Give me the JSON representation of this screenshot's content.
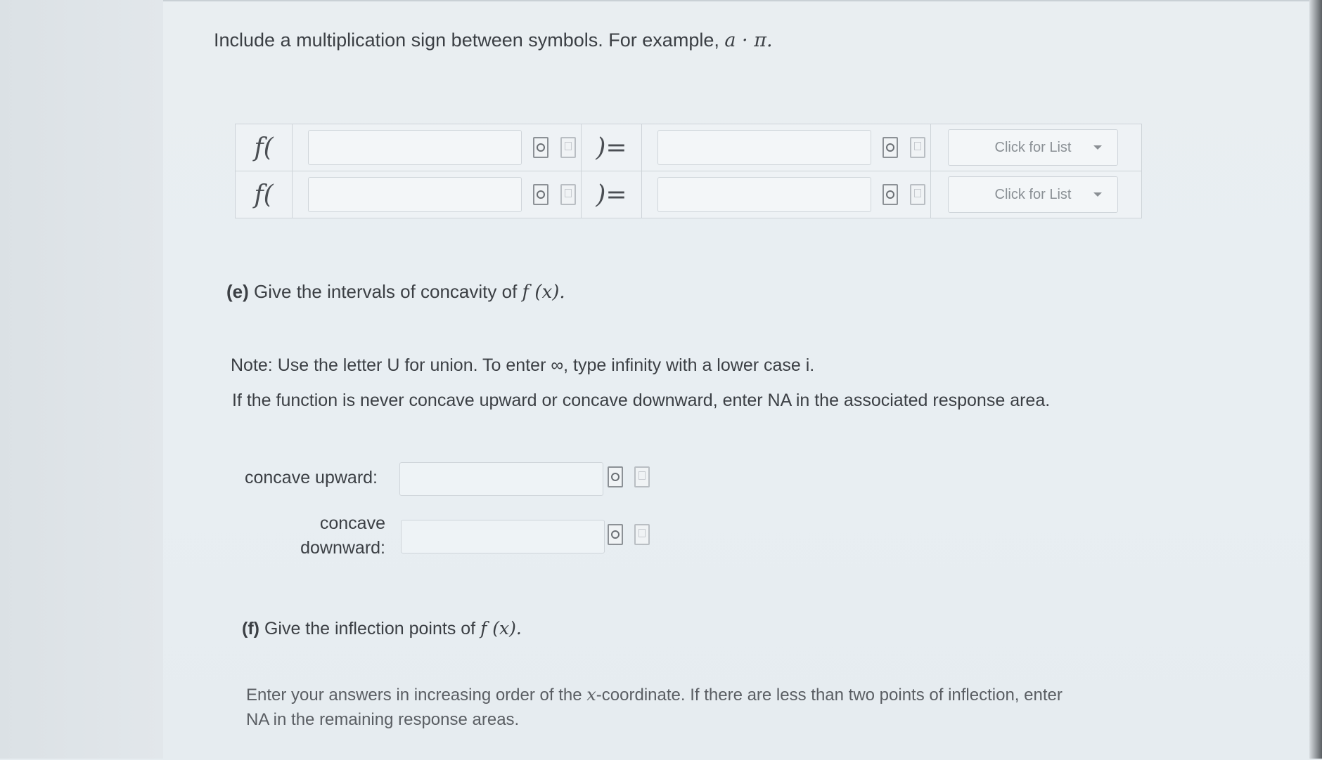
{
  "instruction": {
    "text": "Include a multiplication sign between symbols. For example,",
    "example": "a · π."
  },
  "table": {
    "rows": [
      {
        "func_prefix": "f(",
        "input_value": "",
        "eq": ")=",
        "output_value": "",
        "dropdown": "Click for List"
      },
      {
        "func_prefix": "f(",
        "input_value": "",
        "eq": ")=",
        "output_value": "",
        "dropdown": "Click for List"
      }
    ]
  },
  "part_e": {
    "label": "(e)",
    "text": "Give the intervals of concavity of",
    "math": "f (x)."
  },
  "notes": {
    "line1": "Note: Use the letter U for union. To enter ∞, type infinity with a lower case i.",
    "line2": "If the function is never concave upward or concave downward, enter NA in the associated response area."
  },
  "concavity": {
    "up_label": "concave upward:",
    "down_label_1": "concave",
    "down_label_2": "downward:",
    "up_value": "",
    "down_value": ""
  },
  "part_f": {
    "label": "(f)",
    "text": "Give the inflection points of",
    "math": "f (x)."
  },
  "enter_note": {
    "line1_start": "Enter your answers in increasing order of the",
    "var": "x",
    "line1_end": "-coordinate. If there are less than two points of inflection, enter",
    "line2": "NA in the remaining response areas."
  },
  "icons": {
    "preview": "preview-icon",
    "blank": "blank-page-icon"
  }
}
